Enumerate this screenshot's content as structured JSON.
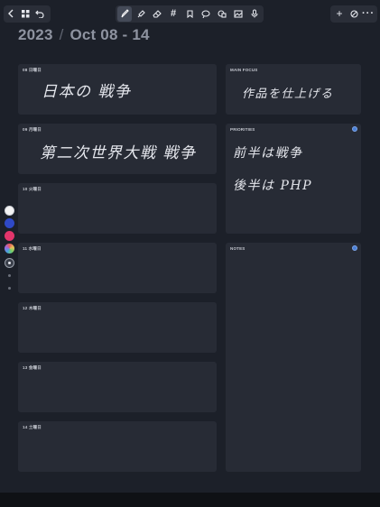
{
  "toolbar": {
    "left": [
      "back",
      "grid",
      "undo"
    ],
    "center": [
      "pen",
      "highlighter",
      "eraser",
      "hashtag",
      "bookmark",
      "lasso",
      "shapes",
      "image",
      "microphone"
    ],
    "right": [
      "add",
      "hide",
      "more"
    ]
  },
  "header": {
    "year": "2023",
    "separator": "/",
    "range": "Oct  08 - 14"
  },
  "days": [
    {
      "label": "08 日曜日",
      "ink": "日本の 戦争"
    },
    {
      "label": "09 月曜日",
      "ink": "第二次世界大戦 戦争"
    },
    {
      "label": "10 火曜日",
      "ink": ""
    },
    {
      "label": "11 水曜日",
      "ink": ""
    },
    {
      "label": "12 木曜日",
      "ink": ""
    },
    {
      "label": "13 金曜日",
      "ink": ""
    },
    {
      "label": "14 土曜日",
      "ink": ""
    }
  ],
  "main_focus": {
    "label": "MAIN FOCUS",
    "ink": "作品を仕上げる"
  },
  "priorities": {
    "label": "PRIORITIES",
    "ink_lines": [
      "前半は戦争",
      "後半は PHP"
    ]
  },
  "notes": {
    "label": "NOTES"
  },
  "palette": {
    "colors": [
      "#f4f4f4",
      "#2f49c6",
      "#e2356b",
      "#e8c35a"
    ],
    "selected_size": "medium"
  },
  "colors": {
    "background": "#1c2029",
    "card": "#272b35",
    "accent": "#4a7fd6"
  }
}
